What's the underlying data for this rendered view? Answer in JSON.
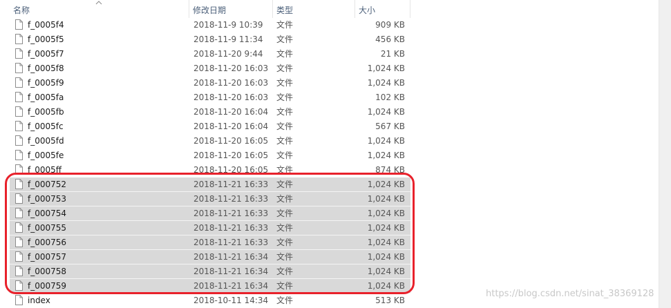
{
  "columns": {
    "name": "名称",
    "date": "修改日期",
    "type": "类型",
    "size": "大小"
  },
  "files": [
    {
      "name": "f_0005f4",
      "date": "2018-11-9 10:39",
      "type": "文件",
      "size": "909 KB",
      "selected": false
    },
    {
      "name": "f_0005f5",
      "date": "2018-11-9 11:34",
      "type": "文件",
      "size": "456 KB",
      "selected": false
    },
    {
      "name": "f_0005f7",
      "date": "2018-11-20 9:44",
      "type": "文件",
      "size": "21 KB",
      "selected": false
    },
    {
      "name": "f_0005f8",
      "date": "2018-11-20 16:03",
      "type": "文件",
      "size": "1,024 KB",
      "selected": false
    },
    {
      "name": "f_0005f9",
      "date": "2018-11-20 16:03",
      "type": "文件",
      "size": "1,024 KB",
      "selected": false
    },
    {
      "name": "f_0005fa",
      "date": "2018-11-20 16:03",
      "type": "文件",
      "size": "102 KB",
      "selected": false
    },
    {
      "name": "f_0005fb",
      "date": "2018-11-20 16:04",
      "type": "文件",
      "size": "1,024 KB",
      "selected": false
    },
    {
      "name": "f_0005fc",
      "date": "2018-11-20 16:04",
      "type": "文件",
      "size": "567 KB",
      "selected": false
    },
    {
      "name": "f_0005fd",
      "date": "2018-11-20 16:05",
      "type": "文件",
      "size": "1,024 KB",
      "selected": false
    },
    {
      "name": "f_0005fe",
      "date": "2018-11-20 16:05",
      "type": "文件",
      "size": "1,024 KB",
      "selected": false
    },
    {
      "name": "f_0005ff",
      "date": "2018-11-20 16:05",
      "type": "文件",
      "size": "874 KB",
      "selected": false
    },
    {
      "name": "f_000752",
      "date": "2018-11-21 16:33",
      "type": "文件",
      "size": "1,024 KB",
      "selected": true
    },
    {
      "name": "f_000753",
      "date": "2018-11-21 16:33",
      "type": "文件",
      "size": "1,024 KB",
      "selected": true
    },
    {
      "name": "f_000754",
      "date": "2018-11-21 16:33",
      "type": "文件",
      "size": "1,024 KB",
      "selected": true
    },
    {
      "name": "f_000755",
      "date": "2018-11-21 16:33",
      "type": "文件",
      "size": "1,024 KB",
      "selected": true
    },
    {
      "name": "f_000756",
      "date": "2018-11-21 16:33",
      "type": "文件",
      "size": "1,024 KB",
      "selected": true
    },
    {
      "name": "f_000757",
      "date": "2018-11-21 16:34",
      "type": "文件",
      "size": "1,024 KB",
      "selected": true
    },
    {
      "name": "f_000758",
      "date": "2018-11-21 16:34",
      "type": "文件",
      "size": "1,024 KB",
      "selected": true
    },
    {
      "name": "f_000759",
      "date": "2018-11-21 16:34",
      "type": "文件",
      "size": "1,024 KB",
      "selected": true
    },
    {
      "name": "index",
      "date": "2018-10-11 14:34",
      "type": "文件",
      "size": "513 KB",
      "selected": false
    }
  ],
  "sort_indicator_icon": "sort-ascending-icon",
  "file_icon": "blank-file-icon",
  "highlight_color": "#e8212b",
  "selection_color": "#d9d9d9",
  "watermark": "https://blog.csdn.net/sinat_38369128"
}
